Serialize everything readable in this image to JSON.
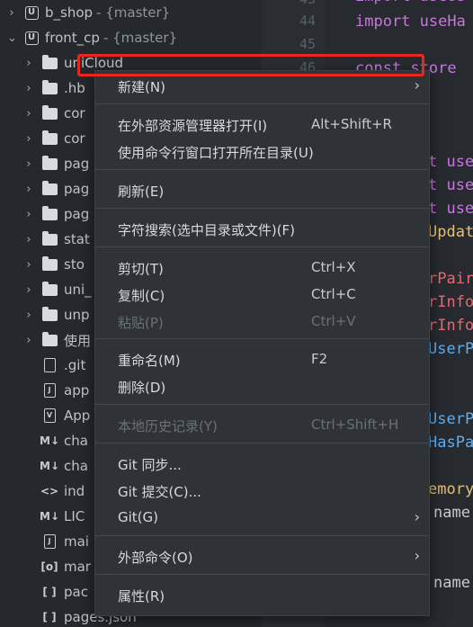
{
  "sidebar": {
    "projects": [
      {
        "name": "b_shop",
        "branch": "- {master}"
      },
      {
        "name": "front_cp",
        "branch": "- {master}"
      }
    ],
    "items": [
      {
        "label": "uniCloud",
        "icon": "folder-icon"
      },
      {
        "label": ".hb",
        "icon": "folder-icon"
      },
      {
        "label": "cor",
        "icon": "folder-icon"
      },
      {
        "label": "cor",
        "icon": "folder-icon"
      },
      {
        "label": "pag",
        "icon": "folder-icon"
      },
      {
        "label": "pag",
        "icon": "folder-icon"
      },
      {
        "label": "pag",
        "icon": "folder-icon"
      },
      {
        "label": "stat",
        "icon": "folder-icon"
      },
      {
        "label": "sto",
        "icon": "folder-icon"
      },
      {
        "label": "uni_",
        "icon": "folder-icon"
      },
      {
        "label": "unp",
        "icon": "folder-icon"
      },
      {
        "label": "使用",
        "icon": "folder-icon"
      },
      {
        "label": ".git",
        "icon": "file-icon"
      },
      {
        "label": "app",
        "icon": "js-file-icon"
      },
      {
        "label": "App",
        "icon": "vue-file-icon"
      },
      {
        "label": "cha",
        "icon": "markdown-file-icon"
      },
      {
        "label": "cha",
        "icon": "markdown-file-icon"
      },
      {
        "label": "ind",
        "icon": "html-file-icon"
      },
      {
        "label": "LIC",
        "icon": "markdown-file-icon"
      },
      {
        "label": "mai",
        "icon": "js-file-icon"
      },
      {
        "label": "mar",
        "icon": "manifest-file-icon"
      },
      {
        "label": "pac",
        "icon": "json-file-icon"
      },
      {
        "label": "pages.json",
        "icon": "json-file-icon"
      }
    ]
  },
  "editor": {
    "line_numbers": [
      "43",
      "44",
      "45",
      "46"
    ],
    "code_lines": [
      {
        "text": "import useUs",
        "color": "#c678dd"
      },
      {
        "text": "import useHa",
        "color": "#c678dd"
      },
      {
        "text": "",
        "color": "#c678dd"
      },
      {
        "text": "const store",
        "color": "#c678dd"
      },
      {
        "text": "t use",
        "color": "#c678dd"
      },
      {
        "text": "t use",
        "color": "#c678dd"
      },
      {
        "text": "t use",
        "color": "#c678dd"
      },
      {
        "text": "Update",
        "color": "#e5c07b"
      },
      {
        "text": "rPair",
        "color": "#e06c75"
      },
      {
        "text": "rInfo",
        "color": "#e06c75"
      },
      {
        "text": "rInfo",
        "color": "#e06c75"
      },
      {
        "text": "UserP",
        "color": "#61afef"
      },
      {
        "text": "UserP",
        "color": "#61afef"
      },
      {
        "text": "HasPa",
        "color": "#61afef"
      },
      {
        "text": "emory",
        "color": "#e5c07b"
      },
      {
        "text": "name",
        "color": "#c7cbd0"
      },
      {
        "text": "name",
        "color": "#c7cbd0"
      }
    ]
  },
  "context_menu": {
    "new": {
      "label": "新建(N)"
    },
    "open_explorer": {
      "label": "在外部资源管理器打开(I)",
      "shortcut": "Alt+Shift+R"
    },
    "open_terminal": {
      "label": "使用命令行窗口打开所在目录(U)"
    },
    "refresh": {
      "label": "刷新(E)"
    },
    "search": {
      "label": "字符搜索(选中目录或文件)(F)"
    },
    "cut": {
      "label": "剪切(T)",
      "shortcut": "Ctrl+X"
    },
    "copy": {
      "label": "复制(C)",
      "shortcut": "Ctrl+C"
    },
    "paste": {
      "label": "粘贴(P)",
      "shortcut": "Ctrl+V"
    },
    "rename": {
      "label": "重命名(M)",
      "shortcut": "F2"
    },
    "delete": {
      "label": "删除(D)"
    },
    "history": {
      "label": "本地历史记录(Y)",
      "shortcut": "Ctrl+Shift+H"
    },
    "git_sync": {
      "label": "Git 同步..."
    },
    "git_commit": {
      "label": "Git 提交(C)..."
    },
    "git": {
      "label": "Git(G)"
    },
    "external": {
      "label": "外部命令(O)"
    },
    "properties": {
      "label": "属性(R)"
    }
  },
  "colors": {
    "highlight_border": "#e8281f",
    "menu_bg": "#2f3237"
  }
}
